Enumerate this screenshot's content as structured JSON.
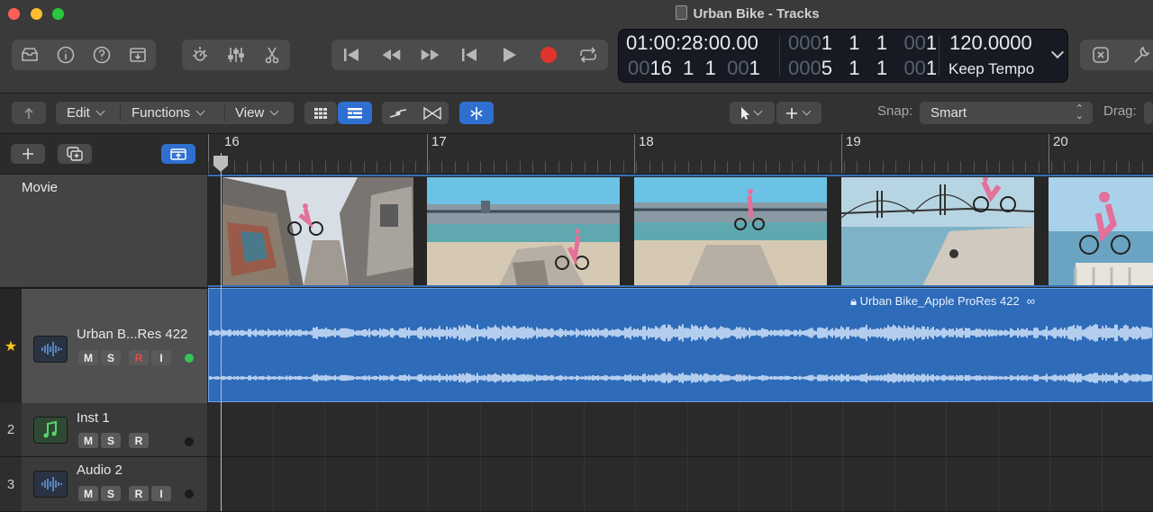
{
  "window": {
    "title": "Urban Bike - Tracks"
  },
  "lcd": {
    "smpte": "01:00:28:00.00",
    "smpte_dim": "",
    "bars_dim_prefix": "00",
    "bars_value": "16  1  1  ",
    "bars_dim_ticks": "00",
    "bars_ticks": "1",
    "locator1_dim": "000",
    "locator1": "1   1   1   ",
    "locator1_dim2": "00",
    "locator1_end": "1",
    "locator2_dim": "000",
    "locator2": "5   1   1   ",
    "locator2_dim2": "00",
    "locator2_end": "1",
    "tempo": "120.0000",
    "tempo_mode": "Keep Tempo"
  },
  "toolbar": {
    "edit": "Edit",
    "functions": "Functions",
    "view": "View",
    "snap_label": "Snap:",
    "snap_value": "Smart",
    "drag_label": "Drag:"
  },
  "ruler": {
    "bars": [
      "16",
      "17",
      "18",
      "19",
      "20"
    ]
  },
  "movie": {
    "label": "Movie"
  },
  "tracks": [
    {
      "number": "",
      "name": "Urban B...Res 422",
      "buttons": [
        "M",
        "S",
        "R",
        "I"
      ],
      "type": "audio"
    },
    {
      "number": "2",
      "name": "Inst 1",
      "buttons": [
        "M",
        "S",
        "R"
      ],
      "type": "instrument"
    },
    {
      "number": "3",
      "name": "Audio 2",
      "buttons": [
        "M",
        "S",
        "R",
        "I"
      ],
      "type": "audio"
    }
  ],
  "region": {
    "name": "Urban Bike_Apple ProRes 422"
  },
  "colors": {
    "accent_blue": "#2f6fd0",
    "region_blue": "#2e6bb8",
    "record_red": "#e0332b",
    "active_green": "#36c45a",
    "star_yellow": "#f5c518"
  }
}
